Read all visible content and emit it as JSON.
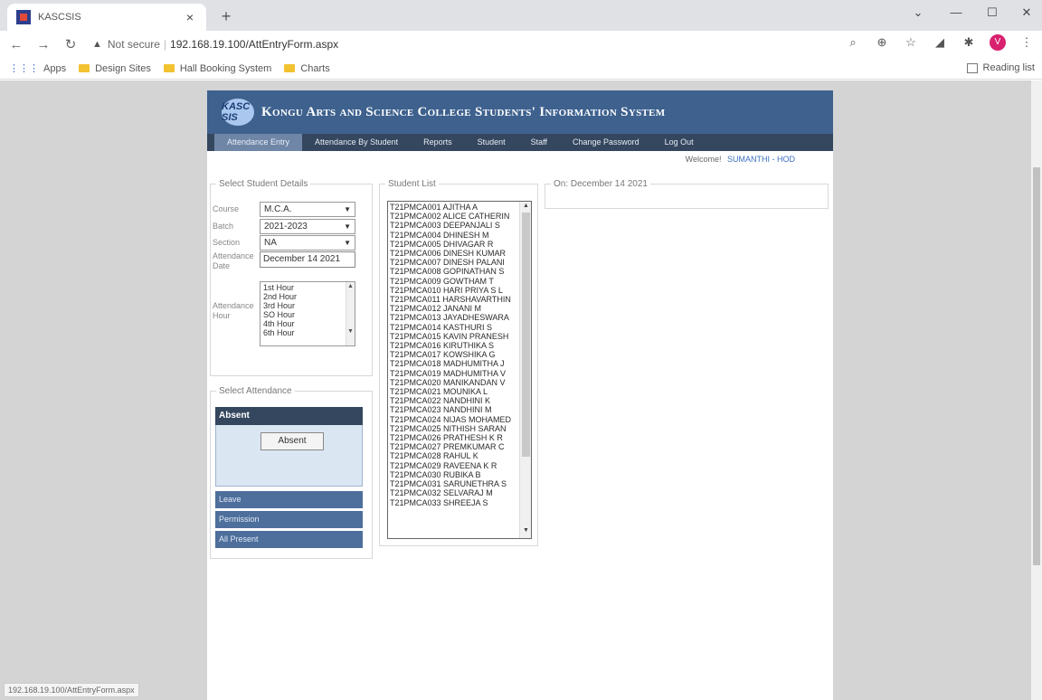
{
  "browser": {
    "tab_title": "KASCSIS",
    "tab_close": "×",
    "new_tab": "+",
    "not_secure": "Not secure",
    "url": "192.168.19.100/AttEntryForm.aspx",
    "bookmarks": [
      "Apps",
      "Design Sites",
      "Hall Booking System",
      "Charts"
    ],
    "reading_list": "Reading list",
    "avatar_letter": "V",
    "status_url": "192.168.19.100/AttEntryForm.aspx"
  },
  "header": {
    "logo_text": "KASC SIS",
    "title": "Kongu Arts and Science College Students' Information System"
  },
  "menu": [
    "Attendance Entry",
    "Attendance By Student",
    "Reports",
    "Student",
    "Staff",
    "Change Password",
    "Log Out"
  ],
  "welcome": {
    "label": "Welcome!",
    "user": "SUMANTHI - HOD"
  },
  "details": {
    "legend": "Select Student Details",
    "course_label": "Course",
    "course_value": "M.C.A.",
    "batch_label": "Batch",
    "batch_value": "2021-2023",
    "section_label": "Section",
    "section_value": "NA",
    "date_label": "Attendance Date",
    "date_value": "December 14 2021",
    "hour_label": "Attendance Hour",
    "hours": [
      "1st Hour",
      "2nd Hour",
      "3rd Hour",
      "SO Hour",
      "4th Hour",
      "6th Hour"
    ]
  },
  "attendance": {
    "legend": "Select Attendance",
    "absent_header": "Absent",
    "absent_button": "Absent",
    "leave": "Leave",
    "permission": "Permission",
    "all_present": "All Present"
  },
  "student_list": {
    "legend": "Student List",
    "students": [
      "T21PMCA001 AJITHA A",
      "T21PMCA002 ALICE CATHERIN",
      "T21PMCA003 DEEPANJALI S",
      "T21PMCA004 DHINESH M",
      "T21PMCA005 DHIVAGAR R",
      "T21PMCA006 DINESH KUMAR",
      "T21PMCA007 DINESH PALANI",
      "T21PMCA008 GOPINATHAN S",
      "T21PMCA009 GOWTHAM T",
      "T21PMCA010 HARI PRIYA S L",
      "T21PMCA011 HARSHAVARTHIN",
      "T21PMCA012 JANANI M",
      "T21PMCA013 JAYADHESWARA",
      "T21PMCA014 KASTHURI S",
      "T21PMCA015 KAVIN PRANESH",
      "T21PMCA016 KIRUTHIKA S",
      "T21PMCA017 KOWSHIKA G",
      "T21PMCA018 MADHUMITHA J",
      "T21PMCA019 MADHUMITHA V",
      "T21PMCA020 MANIKANDAN V",
      "T21PMCA021 MOUNIKA L",
      "T21PMCA022 NANDHINI K",
      "T21PMCA023 NANDHINI M",
      "T21PMCA024 NIJAS MOHAMED",
      "T21PMCA025 NITHISH SARAN",
      "T21PMCA026 PRATHESH K R",
      "T21PMCA027 PREMKUMAR C",
      "T21PMCA028 RAHUL K",
      "T21PMCA029 RAVEENA K R",
      "T21PMCA030 RUBIKA B",
      "T21PMCA031 SARUNETHRA S",
      "T21PMCA032 SELVARAJ M",
      "T21PMCA033 SHREEJA S"
    ]
  },
  "on_date": {
    "legend": "On: December 14 2021"
  },
  "colors": {
    "header": "#3e618e",
    "menubar": "#35475f",
    "panel_bar": "#4e6f9c",
    "background": "#d4d4d4"
  }
}
